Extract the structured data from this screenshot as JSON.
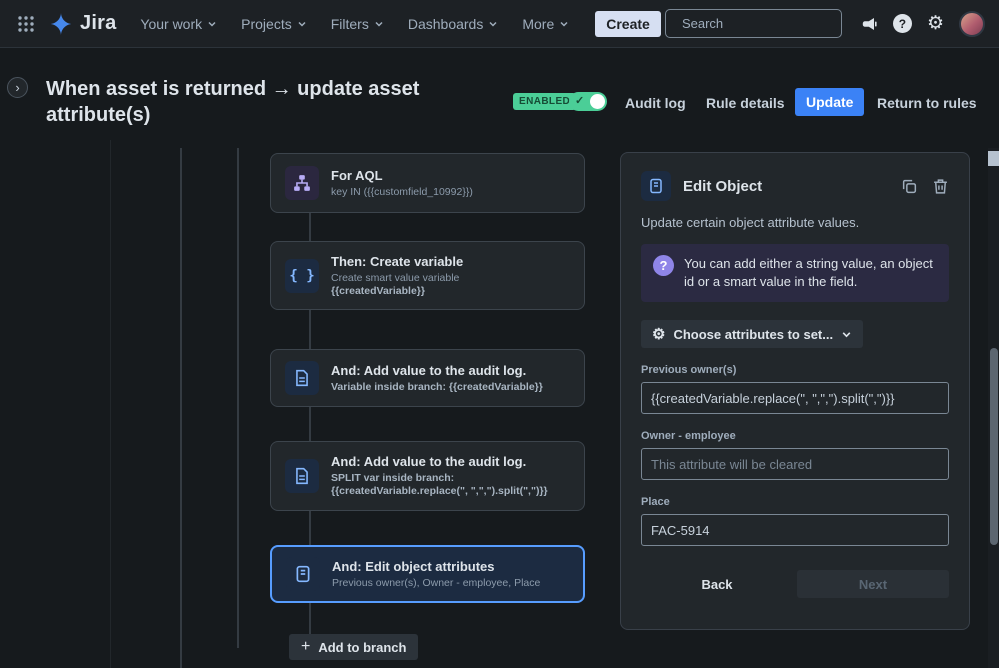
{
  "colors": {
    "accent_blue": "#579dff",
    "success_green": "#4bce97",
    "info_purple": "#8f85e8",
    "surface": "#22272b",
    "background": "#161a1d"
  },
  "navbar": {
    "logo_text": "Jira",
    "items": [
      {
        "label": "Your work"
      },
      {
        "label": "Projects"
      },
      {
        "label": "Filters"
      },
      {
        "label": "Dashboards"
      },
      {
        "label": "More"
      }
    ],
    "create_label": "Create",
    "search_placeholder": "Search"
  },
  "header": {
    "title": "When asset is returned → update asset attribute(s)",
    "enabled_badge": "ENABLED",
    "audit_log_label": "Audit log",
    "rule_details_label": "Rule details",
    "update_label": "Update",
    "return_label": "Return to rules"
  },
  "canvas": {
    "nodes": [
      {
        "title": "For AQL",
        "subtitle": "key IN ({{customfield_10992}})"
      },
      {
        "title": "Then: Create variable",
        "subtitle": "Create smart value variable",
        "subtitle2": "{{createdVariable}}"
      },
      {
        "title": "And: Add value to the audit log.",
        "subtitle": "Variable inside branch: {{createdVariable}}"
      },
      {
        "title": "And: Add value to the audit log.",
        "subtitle": "SPLIT var inside branch: {{createdVariable.replace(\", \",\",\").split(\",\")}}"
      },
      {
        "title": "And: Edit object attributes",
        "subtitle": "Previous owner(s), Owner - employee, Place"
      }
    ],
    "add_to_branch_label": "Add to branch"
  },
  "panel": {
    "title": "Edit Object",
    "description": "Update certain object attribute values.",
    "info_text": "You can add either a string value, an object id or a smart value in the field.",
    "choose_button_label": "Choose attributes to set...",
    "fields": [
      {
        "label": "Previous owner(s)",
        "value": "{{createdVariable.replace(\", \",\",\").split(\",\")}}",
        "placeholder": ""
      },
      {
        "label": "Owner - employee",
        "value": "",
        "placeholder": "This attribute will be cleared"
      },
      {
        "label": "Place",
        "value": "FAC-5914",
        "placeholder": ""
      }
    ],
    "back_label": "Back",
    "next_label": "Next"
  }
}
